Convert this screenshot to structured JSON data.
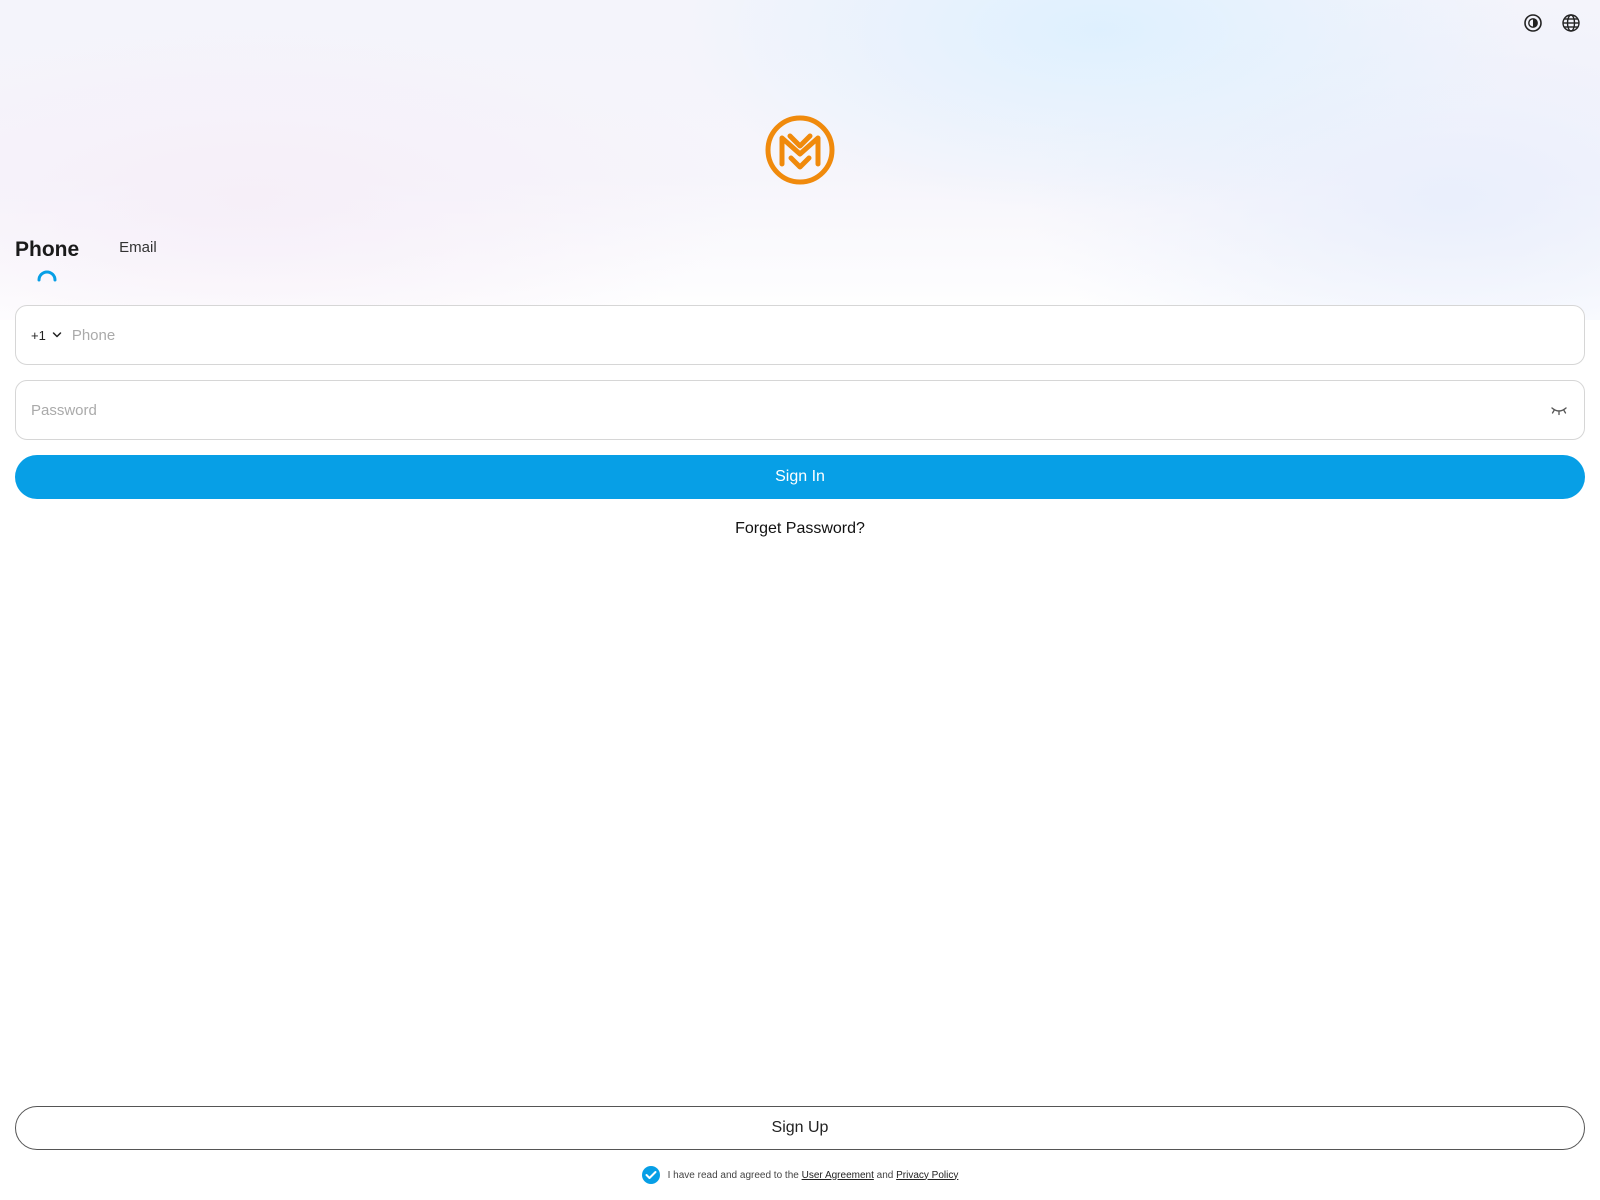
{
  "header": {
    "theme_toggle_icon": "contrast-icon",
    "language_icon": "globe-icon"
  },
  "brand": {
    "logo_icon": "brand-logo",
    "logo_color": "#f08a0c"
  },
  "tabs": [
    {
      "label": "Phone",
      "active": true
    },
    {
      "label": "Email",
      "active": false
    }
  ],
  "form": {
    "country_code": "+1",
    "phone_placeholder": "Phone",
    "password_placeholder": "Password",
    "password_visibility_icon": "eye-closed-icon"
  },
  "actions": {
    "sign_in_label": "Sign In",
    "forget_password_label": "Forget Password?",
    "sign_up_label": "Sign Up"
  },
  "agreement": {
    "checked": true,
    "prefix": "I have read and agreed to the",
    "user_agreement_link": "User Agreement",
    "conjunction": "and",
    "privacy_policy_link": "Privacy Policy"
  },
  "colors": {
    "primary": "#079fe6",
    "brand_orange": "#f08a0c"
  }
}
